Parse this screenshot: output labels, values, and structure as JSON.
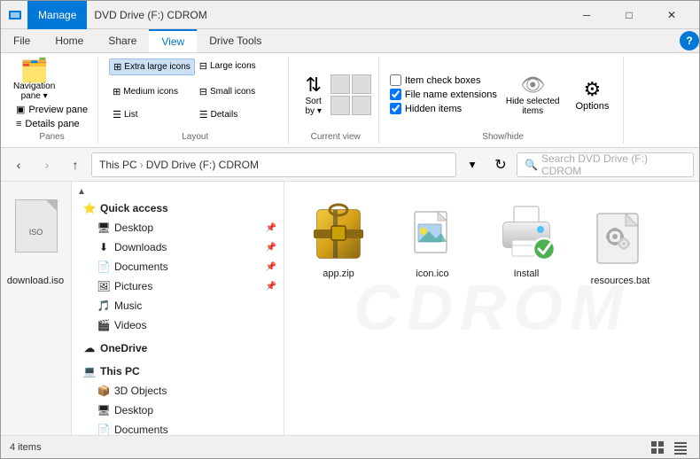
{
  "window": {
    "title": "DVD Drive (F:) CDROM",
    "manage_tab": "Manage"
  },
  "titlebar_buttons": {
    "minimize": "─",
    "maximize": "□",
    "close": "✕"
  },
  "ribbon": {
    "tabs": [
      "File",
      "Home",
      "Share",
      "View",
      "Drive Tools"
    ],
    "active_tab": "View",
    "groups": {
      "panes": {
        "label": "Panes",
        "nav_pane": "Navigation\npane",
        "preview_pane": "Preview pane",
        "details_pane": "Details pane"
      },
      "layout": {
        "label": "Layout",
        "options": [
          "Extra large icons",
          "Large icons",
          "Medium icons",
          "Small icons",
          "List",
          "Details"
        ]
      },
      "current_view": {
        "label": "Current view",
        "sort_by": "Sort\nby"
      },
      "show_hide": {
        "label": "Show/hide",
        "item_check_boxes": "Item check boxes",
        "file_name_extensions": "File name extensions",
        "hidden_items": "Hidden items",
        "hide_selected_items": "Hide selected\nitems",
        "options": "Options"
      }
    }
  },
  "addressbar": {
    "back_tooltip": "Back",
    "forward_tooltip": "Forward",
    "up_tooltip": "Up",
    "path": [
      "This PC",
      "DVD Drive (F:) CDROM"
    ],
    "search_placeholder": "Search DVD Drive (F:) CDROM"
  },
  "sidebar": {
    "quick_access": "Quick access",
    "items": [
      {
        "label": "Desktop",
        "pinned": true,
        "indent": 1
      },
      {
        "label": "Downloads",
        "pinned": true,
        "indent": 1
      },
      {
        "label": "Documents",
        "pinned": true,
        "indent": 1
      },
      {
        "label": "Pictures",
        "pinned": true,
        "indent": 1
      },
      {
        "label": "Music",
        "indent": 1
      },
      {
        "label": "Videos",
        "indent": 1
      }
    ],
    "onedrive": "OneDrive",
    "this_pc": "This PC",
    "this_pc_items": [
      {
        "label": "3D Objects",
        "indent": 1
      },
      {
        "label": "Desktop",
        "indent": 1
      },
      {
        "label": "Documents",
        "indent": 1
      }
    ]
  },
  "files": [
    {
      "name": "app.zip",
      "type": "zip"
    },
    {
      "name": "icon.ico",
      "type": "ico"
    },
    {
      "name": "Install",
      "type": "printer"
    },
    {
      "name": "resources.bat",
      "type": "bat"
    }
  ],
  "left_panel": {
    "filename": "download.iso"
  },
  "statusbar": {
    "count": "4 items"
  },
  "watermark": "CDROM",
  "checkboxes": {
    "item_check_boxes": false,
    "file_name_extensions": true,
    "hidden_items": true
  }
}
